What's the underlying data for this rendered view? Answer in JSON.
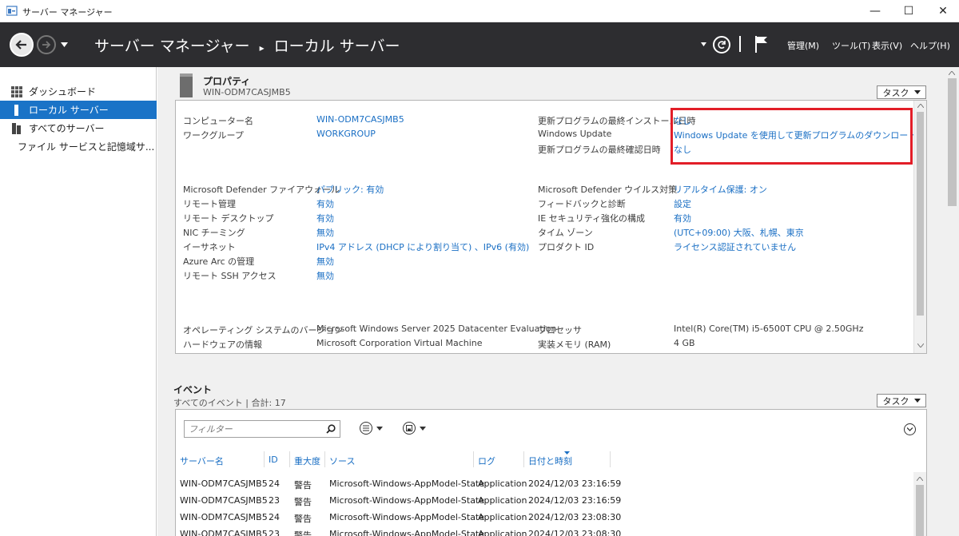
{
  "window": {
    "title": "サーバー マネージャー",
    "minimize": "—",
    "maximize": "☐",
    "close": "✕"
  },
  "header": {
    "breadcrumb_root": "サーバー マネージャー",
    "breadcrumb_sep": "▸",
    "breadcrumb_current": "ローカル サーバー",
    "menu": {
      "manage": "管理(M)",
      "tools": "ツール(T)",
      "view": "表示(V)",
      "help": "ヘルプ(H)"
    }
  },
  "sidebar": {
    "items": [
      {
        "label": "ダッシュボード"
      },
      {
        "label": "ローカル サーバー"
      },
      {
        "label": "すべてのサーバー"
      },
      {
        "label": "ファイル サービスと記憶域サ..."
      }
    ]
  },
  "properties": {
    "title": "プロパティ",
    "subtitle": "WIN-ODM7CASJMB5",
    "task_label": "タスク",
    "left": [
      {
        "label": "コンピューター名",
        "value": "WIN-ODM7CASJMB5"
      },
      {
        "label": "ワークグループ",
        "value": "WORKGROUP"
      },
      {
        "label": "Microsoft Defender ファイアウォール",
        "value": "パブリック: 有効"
      },
      {
        "label": "リモート管理",
        "value": "有効"
      },
      {
        "label": "リモート デスクトップ",
        "value": "有効"
      },
      {
        "label": "NIC チーミング",
        "value": "無効"
      },
      {
        "label": "イーサネット",
        "value": "IPv4 アドレス (DHCP により割り当て) 、IPv6 (有効)"
      },
      {
        "label": "Azure Arc の管理",
        "value": "無効"
      },
      {
        "label": "リモート SSH アクセス",
        "value": "無効"
      },
      {
        "label": "オペレーティング システムのバージョン",
        "value": "Microsoft Windows Server 2025 Datacenter Evaluation"
      },
      {
        "label": "ハードウェアの情報",
        "value": "Microsoft Corporation Virtual Machine"
      }
    ],
    "right": [
      {
        "label": "更新プログラムの最終インストール日時",
        "value": "なし"
      },
      {
        "label": "Windows Update",
        "value": "Windows Update を使用して更新プログラムのダウンロードのみを行う"
      },
      {
        "label": "更新プログラムの最終確認日時",
        "value": "なし"
      },
      {
        "label": "Microsoft Defender ウイルス対策",
        "value": "リアルタイム保護: オン"
      },
      {
        "label": "フィードバックと診断",
        "value": "設定"
      },
      {
        "label": "IE セキュリティ強化の構成",
        "value": "有効"
      },
      {
        "label": "タイム ゾーン",
        "value": "(UTC+09:00) 大阪、札幌、東京"
      },
      {
        "label": "プロダクト ID",
        "value": "ライセンス認証されていません"
      },
      {
        "label": "プロセッサ",
        "value": "Intel(R) Core(TM) i5-6500T CPU @ 2.50GHz"
      },
      {
        "label": "実装メモリ (RAM)",
        "value": "4 GB"
      }
    ]
  },
  "events": {
    "title": "イベント",
    "subtitle": "すべてのイベント | 合計: 17",
    "task_label": "タスク",
    "filter_placeholder": "フィルター",
    "columns": [
      "サーバー名",
      "ID",
      "重大度",
      "ソース",
      "ログ",
      "日付と時刻"
    ],
    "rows": [
      [
        "WIN-ODM7CASJMB5",
        "24",
        "警告",
        "Microsoft-Windows-AppModel-State",
        "Application",
        "2024/12/03 23:16:59"
      ],
      [
        "WIN-ODM7CASJMB5",
        "23",
        "警告",
        "Microsoft-Windows-AppModel-State",
        "Application",
        "2024/12/03 23:16:59"
      ],
      [
        "WIN-ODM7CASJMB5",
        "24",
        "警告",
        "Microsoft-Windows-AppModel-State",
        "Application",
        "2024/12/03 23:08:30"
      ],
      [
        "WIN-ODM7CASJMB5",
        "23",
        "警告",
        "Microsoft-Windows-AppModel-State",
        "Application",
        "2024/12/03 23:08:30"
      ]
    ]
  },
  "colors": {
    "accent": "#1a73c7",
    "header_bg": "#2d2d30",
    "highlight": "#e21e28",
    "link": "#1a6fc4"
  }
}
